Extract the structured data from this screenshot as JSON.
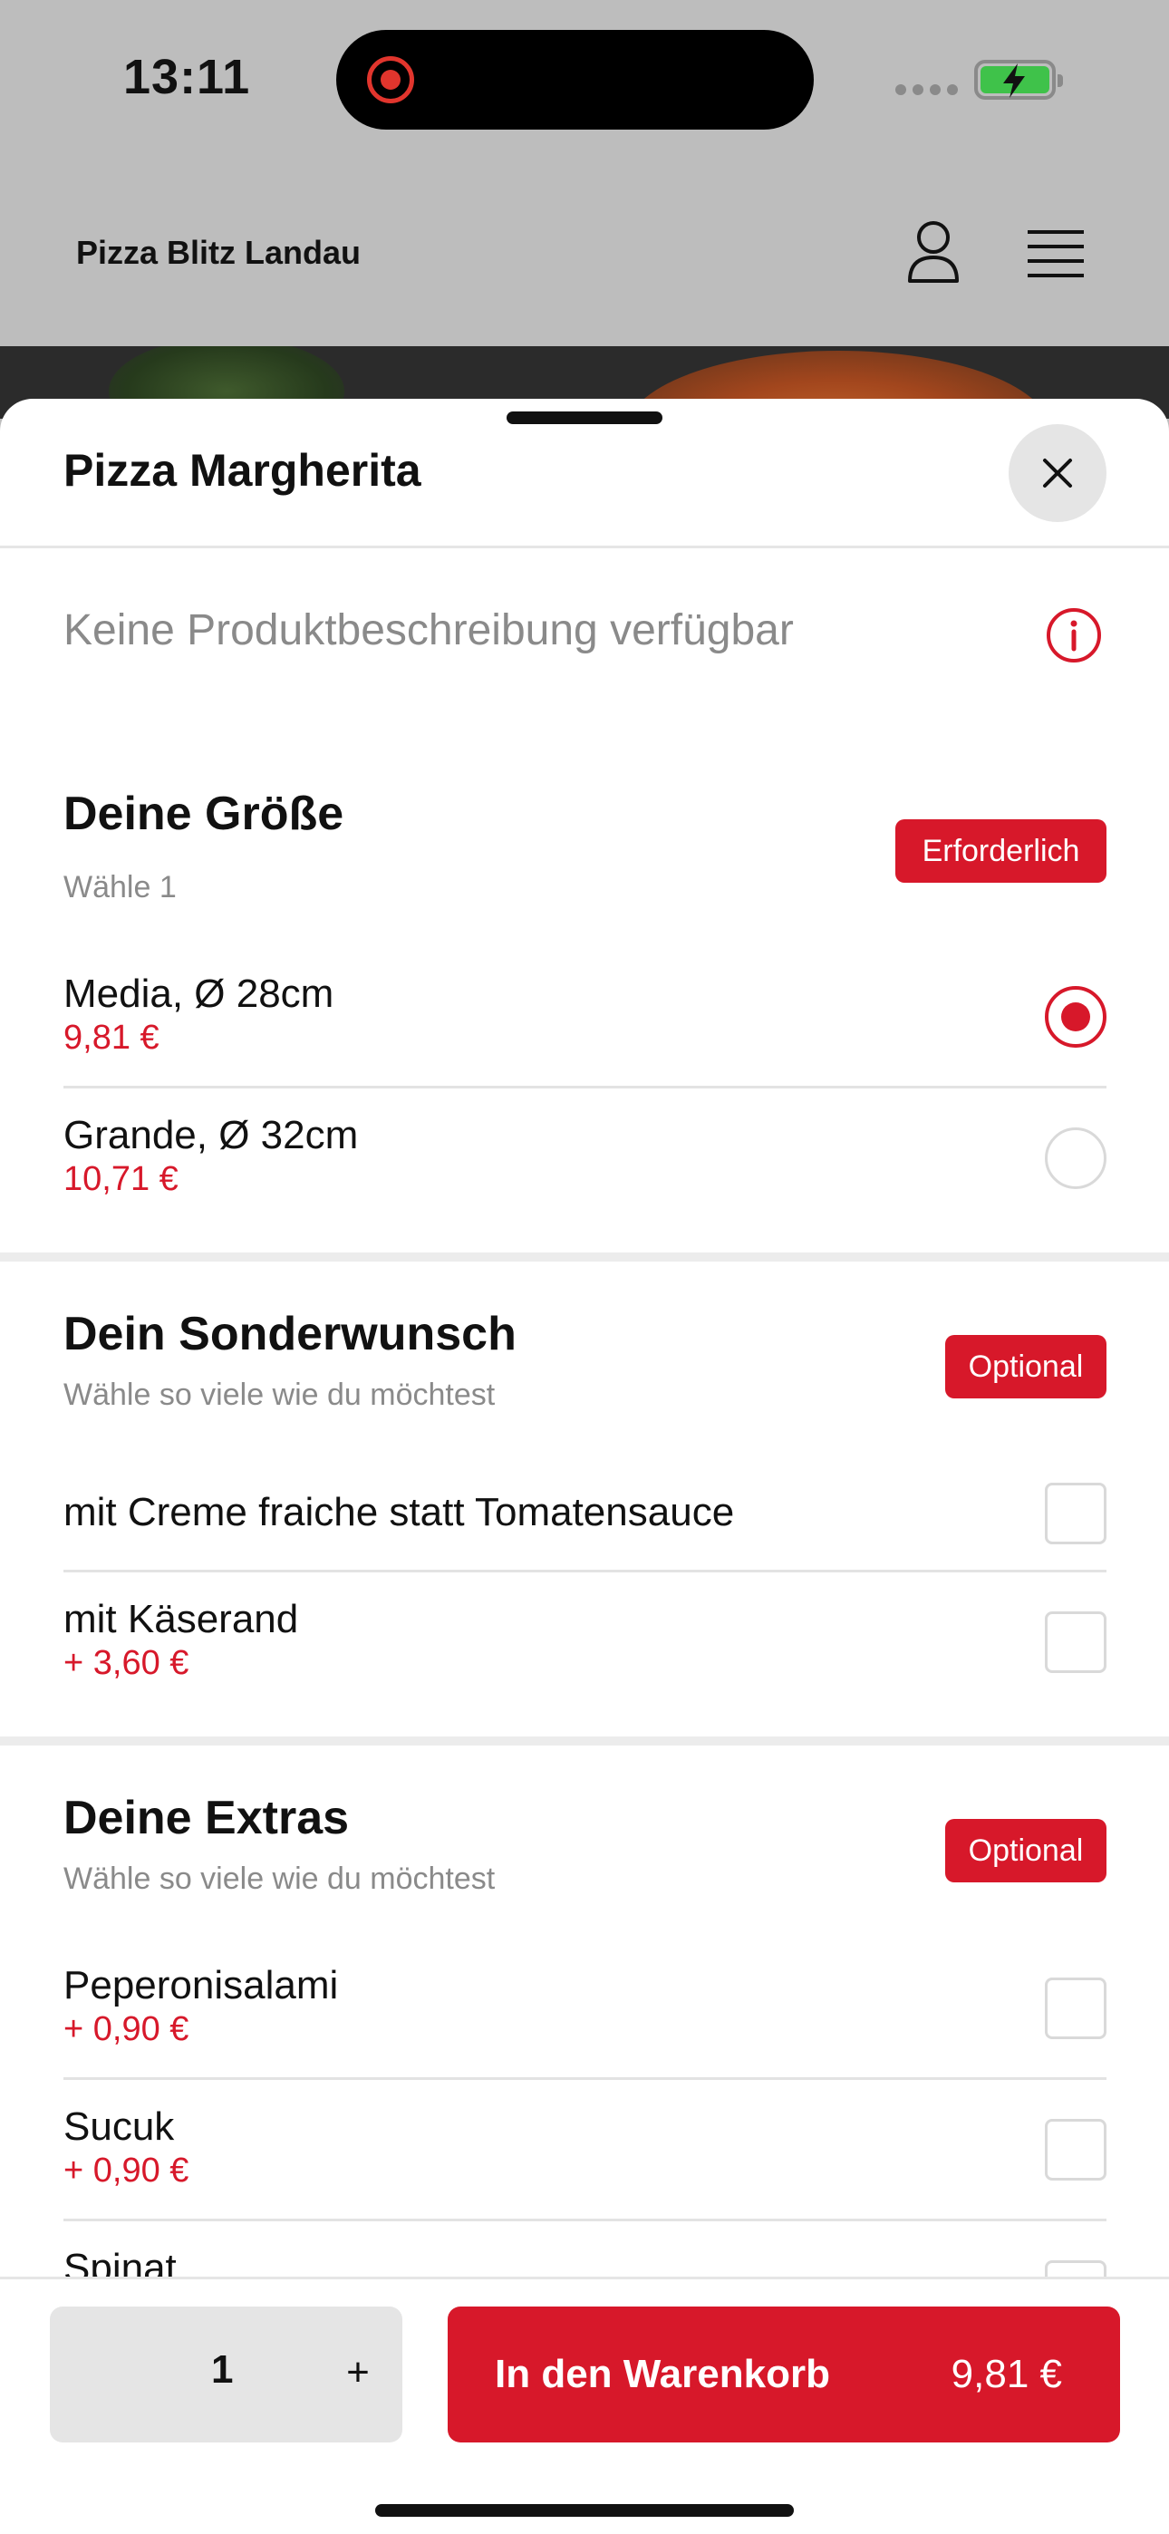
{
  "status_bar": {
    "time": "13:11"
  },
  "header": {
    "brand": "Pizza Blitz Landau"
  },
  "product": {
    "title": "Pizza Margherita",
    "description": "Keine Produktbeschreibung verfügbar"
  },
  "groups": [
    {
      "title": "Deine Größe",
      "subtitle": "Wähle 1",
      "badge": "Erforderlich",
      "options": [
        {
          "name": "Media, Ø 28cm",
          "price": "9,81 €",
          "selected": true
        },
        {
          "name": "Grande, Ø 32cm",
          "price": "10,71 €",
          "selected": false
        }
      ]
    },
    {
      "title": "Dein Sonderwunsch",
      "subtitle": "Wähle so viele wie du möchtest",
      "badge": "Optional",
      "options": [
        {
          "name": "mit Creme fraiche statt Tomatensauce",
          "price": "",
          "checked": false
        },
        {
          "name": "mit Käserand",
          "price": "+ 3,60 €",
          "checked": false
        }
      ]
    },
    {
      "title": "Deine Extras",
      "subtitle": "Wähle so viele wie du möchtest",
      "badge": "Optional",
      "options": [
        {
          "name": "Peperonisalami",
          "price": "+ 0,90 €",
          "checked": false
        },
        {
          "name": "Sucuk",
          "price": "+ 0,90 €",
          "checked": false
        },
        {
          "name": "Spinat",
          "price": "",
          "checked": false
        }
      ]
    }
  ],
  "footer": {
    "quantity": "1",
    "plus": "+",
    "add_label": "In den Warenkorb",
    "add_price": "9,81 €"
  },
  "colors": {
    "accent": "#d7182a",
    "muted": "#8a8a8a",
    "chip_bg": "#e5e5e5"
  }
}
